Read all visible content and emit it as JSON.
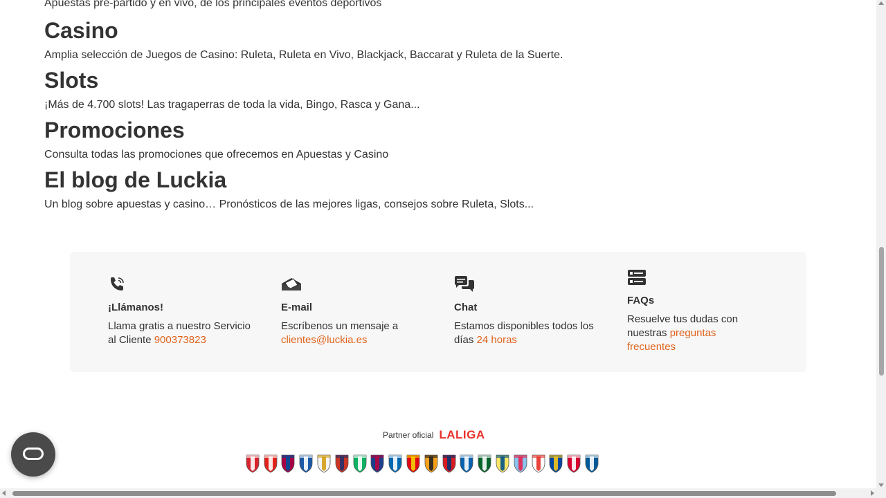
{
  "intro": "Apuestas pre-partido y en vivo, de los principales eventos deportivos",
  "sections": [
    {
      "title": "Casino",
      "desc": "Amplia selección de Juegos de Casino: Ruleta, Ruleta en Vivo, Blackjack, Baccarat y Ruleta de la Suerte."
    },
    {
      "title": "Slots",
      "desc": "¡Más de 4.700 slots! Las tragaperras de toda la vida, Bingo, Rasca y Gana..."
    },
    {
      "title": "Promociones",
      "desc": "Consulta todas las promociones que ofrecemos en Apuestas y Casino"
    },
    {
      "title": "El blog de Luckia",
      "desc": "Un blog sobre apuestas y casino… Pronósticos de las mejores ligas, consejos sobre Ruleta, Slots..."
    }
  ],
  "contact": {
    "phone": {
      "icon": "phone-icon",
      "title": "¡Llámanos!",
      "text": "Llama gratis a nuestro Servicio al Cliente ",
      "link": "900373823"
    },
    "email": {
      "icon": "email-icon",
      "title": "E-mail",
      "text": "Escríbenos un mensaje a ",
      "link": "clientes@luckia.es"
    },
    "chat": {
      "icon": "chat-icon",
      "title": "Chat",
      "text": "Estamos disponibles todos los días ",
      "link": "24 horas"
    },
    "faqs": {
      "icon": "faq-icon",
      "title": "FAQs",
      "text": "Resuelve tus dudas con nuestras ",
      "link": "preguntas frecuentes"
    }
  },
  "partner": {
    "label": "Partner oficial",
    "brand": "LALIGA"
  },
  "crests": [
    {
      "name": "sevilla",
      "c1": "#d8242c",
      "c2": "#ffffff"
    },
    {
      "name": "athletic",
      "c1": "#e2231a",
      "c2": "#ffffff"
    },
    {
      "name": "barcelona",
      "c1": "#a50044",
      "c2": "#004d98"
    },
    {
      "name": "espanyol",
      "c1": "#1c5aa8",
      "c2": "#ffffff"
    },
    {
      "name": "real-madrid",
      "c1": "#f5f5f5",
      "c2": "#d4a017"
    },
    {
      "name": "atletico",
      "c1": "#cb3524",
      "c2": "#27306b"
    },
    {
      "name": "betis",
      "c1": "#0bb363",
      "c2": "#ffffff"
    },
    {
      "name": "levante",
      "c1": "#1b3f8b",
      "c2": "#b4053f"
    },
    {
      "name": "real-sociedad",
      "c1": "#0067b1",
      "c2": "#ffffff"
    },
    {
      "name": "mallorca",
      "c1": "#e20613",
      "c2": "#f4d000"
    },
    {
      "name": "valencia",
      "c1": "#f6a01a",
      "c2": "#222222"
    },
    {
      "name": "osasuna",
      "c1": "#d91a21",
      "c2": "#0a346f"
    },
    {
      "name": "alaves",
      "c1": "#0761af",
      "c2": "#ffffff"
    },
    {
      "name": "elche",
      "c1": "#05642c",
      "c2": "#ffffff"
    },
    {
      "name": "villarreal",
      "c1": "#ffe667",
      "c2": "#005187"
    },
    {
      "name": "celta",
      "c1": "#8ac3ee",
      "c2": "#e5254e"
    },
    {
      "name": "rayo",
      "c1": "#ffffff",
      "c2": "#e53027"
    },
    {
      "name": "oviedo",
      "c1": "#0047a3",
      "c2": "#f5c518"
    },
    {
      "name": "girona",
      "c1": "#d7002f",
      "c2": "#ffffff"
    },
    {
      "name": "getafe",
      "c1": "#005999",
      "c2": "#ffffff"
    }
  ],
  "chat_button_icon": "chat-bubble-icon"
}
